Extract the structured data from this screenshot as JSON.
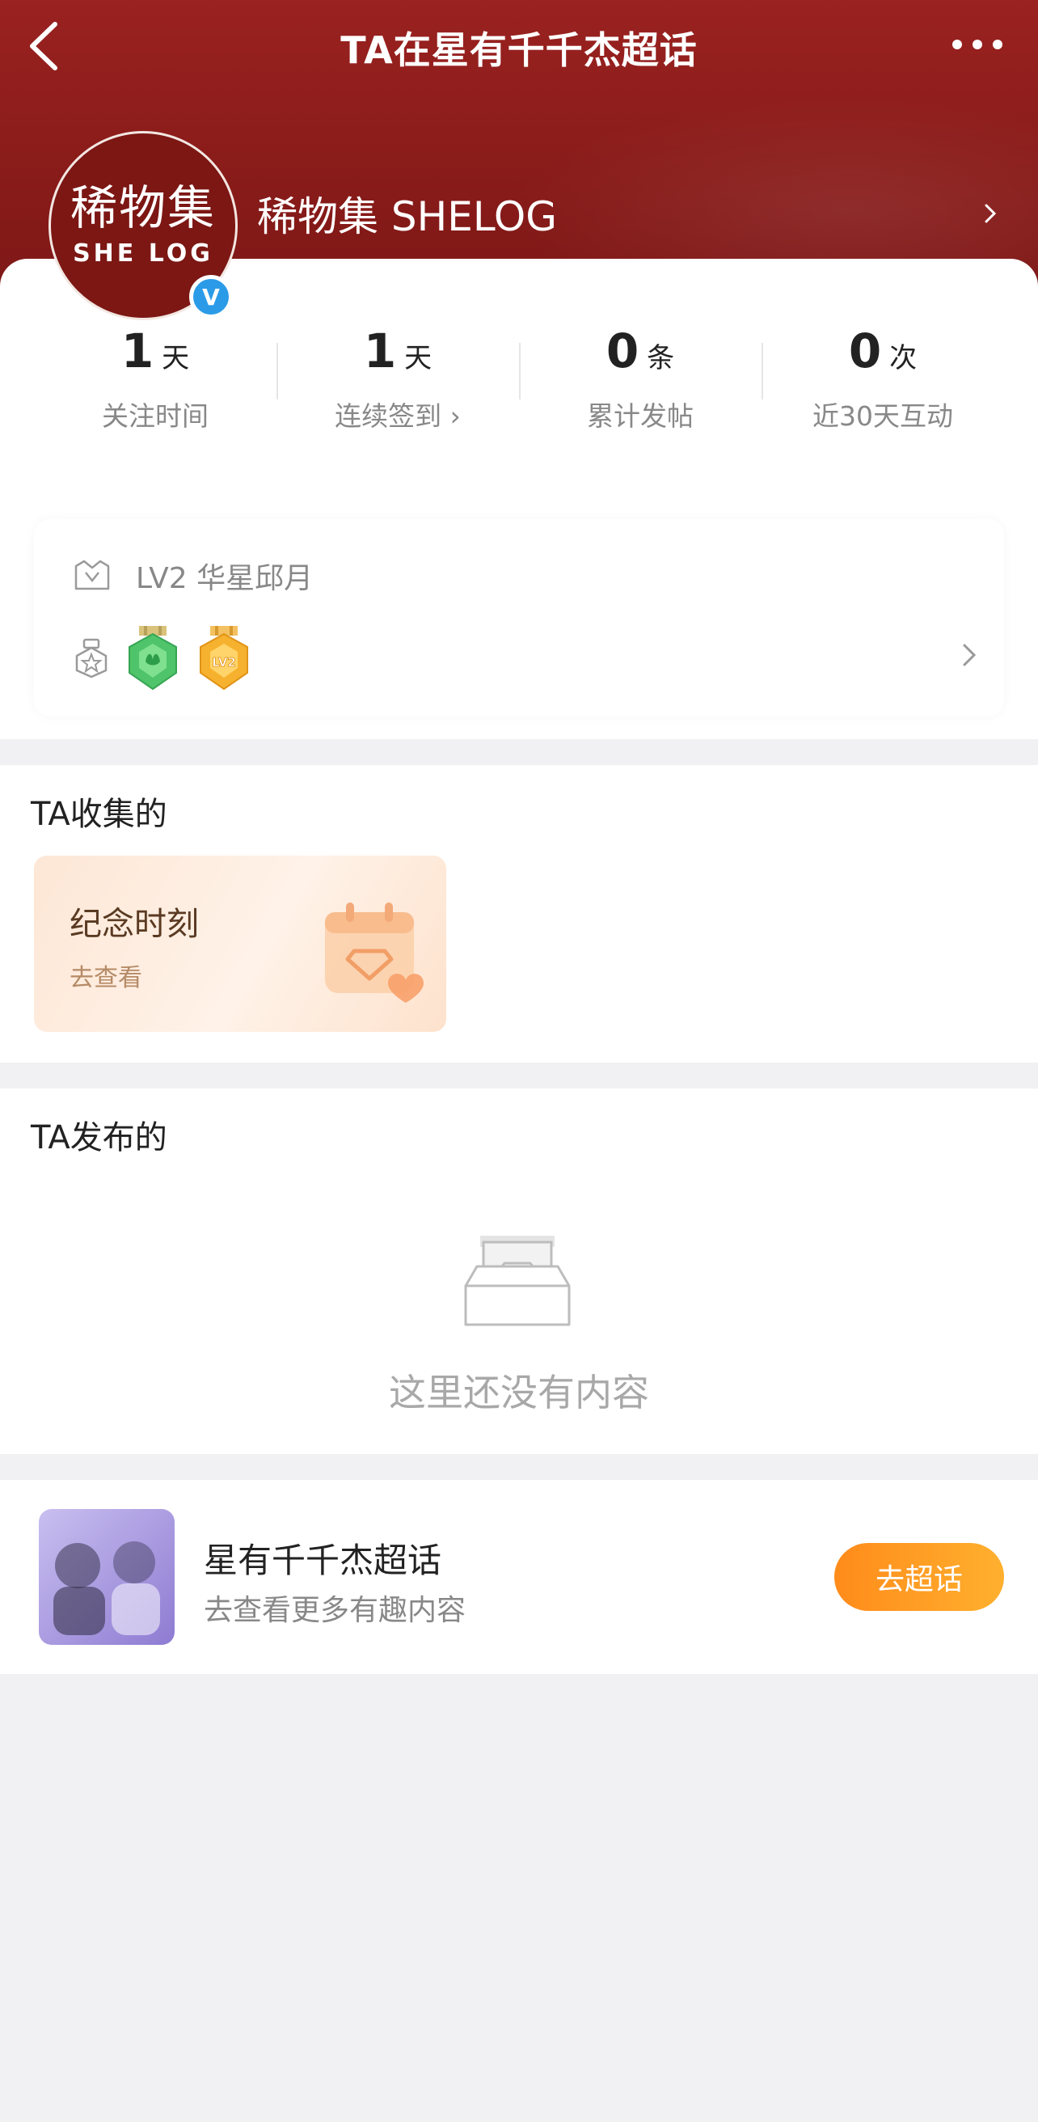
{
  "nav": {
    "title": "TA在星有千千杰超话"
  },
  "profile": {
    "name": "稀物集 SHELOG",
    "avatar_line1": "稀物集",
    "avatar_line2": "SHE LOG",
    "verified_mark": "V"
  },
  "stats": [
    {
      "value": "1",
      "unit": "天",
      "label": "关注时间"
    },
    {
      "value": "1",
      "unit": "天",
      "label": "连续签到 ›"
    },
    {
      "value": "0",
      "unit": "条",
      "label": "累计发帖"
    },
    {
      "value": "0",
      "unit": "次",
      "label": "近30天互动"
    }
  ],
  "level": {
    "text": "LV2 华星邱月",
    "medal_badge_text": "LV2"
  },
  "collected": {
    "title": "TA收集的",
    "card_title": "纪念时刻",
    "card_sub": "去查看"
  },
  "posted": {
    "title": "TA发布的",
    "empty_text": "这里还没有内容"
  },
  "topic": {
    "name": "星有千千杰超话",
    "sub": "去查看更多有趣内容",
    "button": "去超话"
  },
  "colors": {
    "header_bg": "#8a1c1a",
    "accent_orange": "#ff9a22",
    "verified_blue": "#2b9be8"
  },
  "icons": [
    "back-icon",
    "more-icon",
    "chevron-right-icon",
    "level-crown-icon",
    "badge-icon",
    "calendar-heart-icon",
    "empty-box-icon"
  ]
}
